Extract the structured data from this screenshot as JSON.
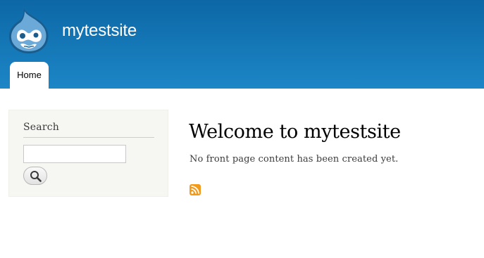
{
  "site": {
    "name": "mytestsite",
    "logo_icon": "drupal-drop-logo",
    "header_colors": [
      "#0d67a6",
      "#1d86c6"
    ]
  },
  "menu": {
    "items": [
      {
        "label": "Home",
        "active": true
      }
    ]
  },
  "sidebar": {
    "search": {
      "title": "Search",
      "input_value": "",
      "input_placeholder": "",
      "button_icon": "magnifier-icon"
    }
  },
  "content": {
    "title": "Welcome to mytestsite",
    "text": "No front page content has been created yet.",
    "feed_icon": "rss-icon",
    "feed_color": "#f39a1b"
  }
}
